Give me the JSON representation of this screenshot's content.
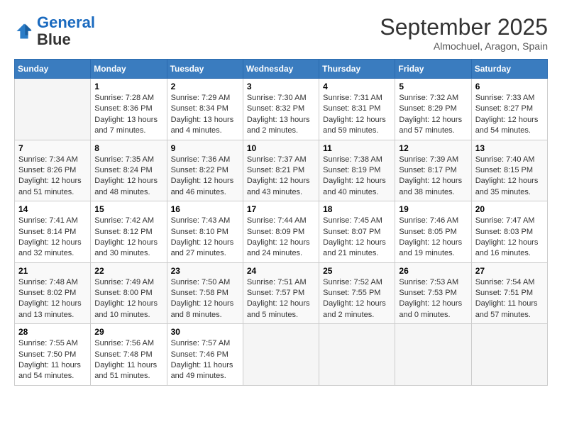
{
  "header": {
    "logo_line1": "General",
    "logo_line2": "Blue",
    "month_title": "September 2025",
    "location": "Almochuel, Aragon, Spain"
  },
  "weekdays": [
    "Sunday",
    "Monday",
    "Tuesday",
    "Wednesday",
    "Thursday",
    "Friday",
    "Saturday"
  ],
  "weeks": [
    [
      {
        "num": "",
        "info": ""
      },
      {
        "num": "1",
        "info": "Sunrise: 7:28 AM\nSunset: 8:36 PM\nDaylight: 13 hours\nand 7 minutes."
      },
      {
        "num": "2",
        "info": "Sunrise: 7:29 AM\nSunset: 8:34 PM\nDaylight: 13 hours\nand 4 minutes."
      },
      {
        "num": "3",
        "info": "Sunrise: 7:30 AM\nSunset: 8:32 PM\nDaylight: 13 hours\nand 2 minutes."
      },
      {
        "num": "4",
        "info": "Sunrise: 7:31 AM\nSunset: 8:31 PM\nDaylight: 12 hours\nand 59 minutes."
      },
      {
        "num": "5",
        "info": "Sunrise: 7:32 AM\nSunset: 8:29 PM\nDaylight: 12 hours\nand 57 minutes."
      },
      {
        "num": "6",
        "info": "Sunrise: 7:33 AM\nSunset: 8:27 PM\nDaylight: 12 hours\nand 54 minutes."
      }
    ],
    [
      {
        "num": "7",
        "info": "Sunrise: 7:34 AM\nSunset: 8:26 PM\nDaylight: 12 hours\nand 51 minutes."
      },
      {
        "num": "8",
        "info": "Sunrise: 7:35 AM\nSunset: 8:24 PM\nDaylight: 12 hours\nand 48 minutes."
      },
      {
        "num": "9",
        "info": "Sunrise: 7:36 AM\nSunset: 8:22 PM\nDaylight: 12 hours\nand 46 minutes."
      },
      {
        "num": "10",
        "info": "Sunrise: 7:37 AM\nSunset: 8:21 PM\nDaylight: 12 hours\nand 43 minutes."
      },
      {
        "num": "11",
        "info": "Sunrise: 7:38 AM\nSunset: 8:19 PM\nDaylight: 12 hours\nand 40 minutes."
      },
      {
        "num": "12",
        "info": "Sunrise: 7:39 AM\nSunset: 8:17 PM\nDaylight: 12 hours\nand 38 minutes."
      },
      {
        "num": "13",
        "info": "Sunrise: 7:40 AM\nSunset: 8:15 PM\nDaylight: 12 hours\nand 35 minutes."
      }
    ],
    [
      {
        "num": "14",
        "info": "Sunrise: 7:41 AM\nSunset: 8:14 PM\nDaylight: 12 hours\nand 32 minutes."
      },
      {
        "num": "15",
        "info": "Sunrise: 7:42 AM\nSunset: 8:12 PM\nDaylight: 12 hours\nand 30 minutes."
      },
      {
        "num": "16",
        "info": "Sunrise: 7:43 AM\nSunset: 8:10 PM\nDaylight: 12 hours\nand 27 minutes."
      },
      {
        "num": "17",
        "info": "Sunrise: 7:44 AM\nSunset: 8:09 PM\nDaylight: 12 hours\nand 24 minutes."
      },
      {
        "num": "18",
        "info": "Sunrise: 7:45 AM\nSunset: 8:07 PM\nDaylight: 12 hours\nand 21 minutes."
      },
      {
        "num": "19",
        "info": "Sunrise: 7:46 AM\nSunset: 8:05 PM\nDaylight: 12 hours\nand 19 minutes."
      },
      {
        "num": "20",
        "info": "Sunrise: 7:47 AM\nSunset: 8:03 PM\nDaylight: 12 hours\nand 16 minutes."
      }
    ],
    [
      {
        "num": "21",
        "info": "Sunrise: 7:48 AM\nSunset: 8:02 PM\nDaylight: 12 hours\nand 13 minutes."
      },
      {
        "num": "22",
        "info": "Sunrise: 7:49 AM\nSunset: 8:00 PM\nDaylight: 12 hours\nand 10 minutes."
      },
      {
        "num": "23",
        "info": "Sunrise: 7:50 AM\nSunset: 7:58 PM\nDaylight: 12 hours\nand 8 minutes."
      },
      {
        "num": "24",
        "info": "Sunrise: 7:51 AM\nSunset: 7:57 PM\nDaylight: 12 hours\nand 5 minutes."
      },
      {
        "num": "25",
        "info": "Sunrise: 7:52 AM\nSunset: 7:55 PM\nDaylight: 12 hours\nand 2 minutes."
      },
      {
        "num": "26",
        "info": "Sunrise: 7:53 AM\nSunset: 7:53 PM\nDaylight: 12 hours\nand 0 minutes."
      },
      {
        "num": "27",
        "info": "Sunrise: 7:54 AM\nSunset: 7:51 PM\nDaylight: 11 hours\nand 57 minutes."
      }
    ],
    [
      {
        "num": "28",
        "info": "Sunrise: 7:55 AM\nSunset: 7:50 PM\nDaylight: 11 hours\nand 54 minutes."
      },
      {
        "num": "29",
        "info": "Sunrise: 7:56 AM\nSunset: 7:48 PM\nDaylight: 11 hours\nand 51 minutes."
      },
      {
        "num": "30",
        "info": "Sunrise: 7:57 AM\nSunset: 7:46 PM\nDaylight: 11 hours\nand 49 minutes."
      },
      {
        "num": "",
        "info": ""
      },
      {
        "num": "",
        "info": ""
      },
      {
        "num": "",
        "info": ""
      },
      {
        "num": "",
        "info": ""
      }
    ]
  ]
}
